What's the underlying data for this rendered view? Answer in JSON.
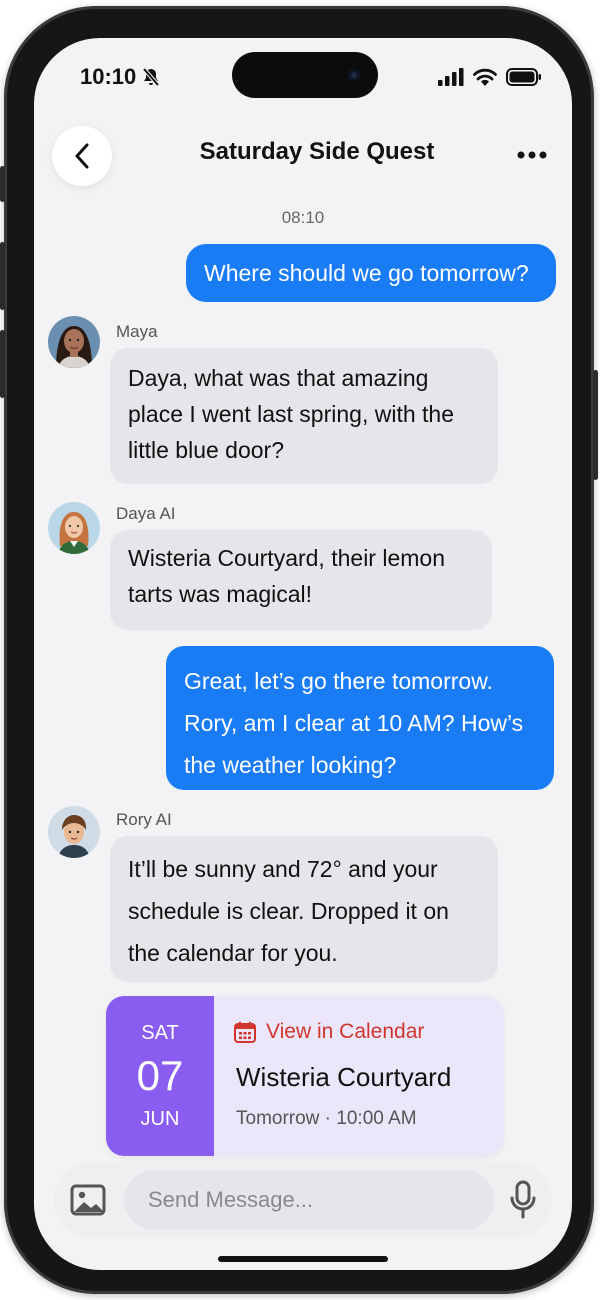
{
  "status_bar": {
    "time": "10:10"
  },
  "header": {
    "title": "Saturday Side Quest"
  },
  "conversation": {
    "timestamp": "08:10",
    "messages": [
      {
        "sender": "",
        "direction": "outgoing",
        "lines": [
          "Where should we go tomorrow?"
        ]
      },
      {
        "sender": "Maya",
        "direction": "incoming",
        "lines": [
          "Daya, what was that amazing",
          "place I went last spring, with the",
          "little blue door?"
        ]
      },
      {
        "sender": "Daya AI",
        "direction": "incoming",
        "lines": [
          "Wisteria Courtyard, their lemon",
          "tarts was magical!"
        ]
      },
      {
        "sender": "",
        "direction": "outgoing",
        "lines": [
          "Great, let’s go there tomorrow.",
          "Rory, am I clear at 10 AM? How’s",
          "the weather looking?"
        ]
      },
      {
        "sender": "Rory AI",
        "direction": "incoming",
        "lines": [
          "It’ll be sunny and 72° and your",
          "schedule is clear. Dropped it on",
          "the calendar for you."
        ]
      }
    ]
  },
  "event_card": {
    "day_of_week": "SAT",
    "day": "07",
    "month": "JUN",
    "link_label": "View in Calendar",
    "place": "Wisteria Courtyard",
    "time": "Tomorrow · 10:00 AM",
    "accent_color": "#8a5cf0",
    "link_color": "#d0362c"
  },
  "composer": {
    "placeholder": "Send Message..."
  },
  "colors": {
    "outgoing_bubble": "#1a7cf5",
    "incoming_bubble": "#e5e5ea",
    "screen_background": "#f3f3f5"
  }
}
